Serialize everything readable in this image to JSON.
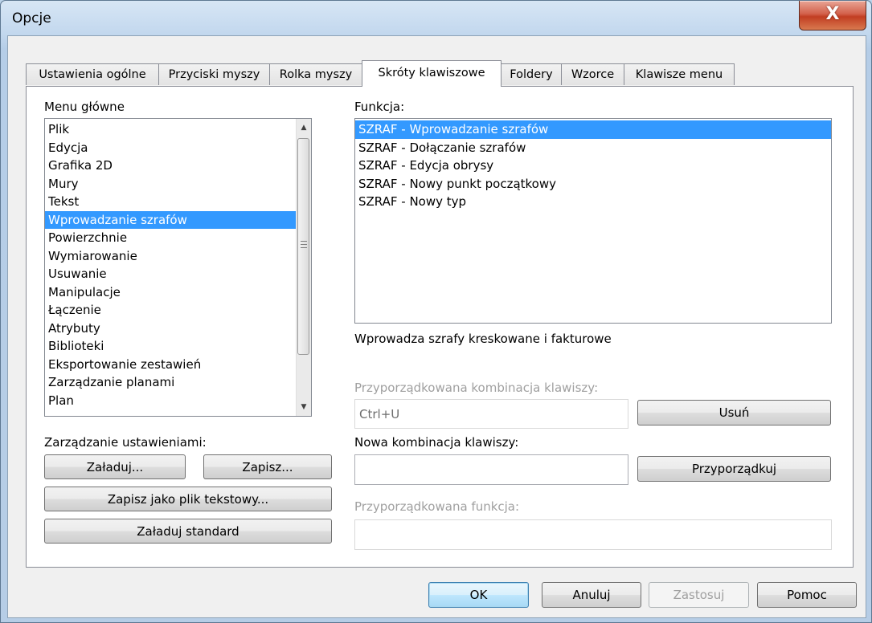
{
  "window": {
    "title": "Opcje",
    "close_glyph": "X"
  },
  "tabs": [
    {
      "label": "Ustawienia ogólne",
      "active": false
    },
    {
      "label": "Przyciski myszy",
      "active": false
    },
    {
      "label": "Rolka myszy",
      "active": false
    },
    {
      "label": "Skróty klawiszowe",
      "active": true
    },
    {
      "label": "Foldery",
      "active": false
    },
    {
      "label": "Wzorce",
      "active": false
    },
    {
      "label": "Klawisze menu",
      "active": false
    }
  ],
  "menu": {
    "label": "Menu główne",
    "items": [
      "Plik",
      "Edycja",
      "Grafika 2D",
      "Mury",
      "Tekst",
      "Wprowadzanie szrafów",
      "Powierzchnie",
      "Wymiarowanie",
      "Usuwanie",
      "Manipulacje",
      "Łączenie",
      "Atrybuty",
      "Biblioteki",
      "Eksportowanie zestawień",
      "Zarządzanie planami",
      "Plan"
    ],
    "selected_index": 5,
    "scroll_up_icon": "scroll-up-arrow",
    "scroll_down_icon": "scroll-down-arrow"
  },
  "settings": {
    "label": "Zarządzanie ustawieniami:",
    "load": "Załaduj...",
    "save": "Zapisz...",
    "save_text": "Zapisz jako plik tekstowy...",
    "load_standard": "Załaduj standard"
  },
  "function": {
    "label": "Funkcja:",
    "items": [
      "SZRAF - Wprowadzanie szrafów",
      "SZRAF - Dołączanie szrafów",
      "SZRAF - Edycja obrysy",
      "SZRAF - Nowy punkt początkowy",
      "SZRAF - Nowy typ"
    ],
    "selected_index": 0,
    "description": "Wprowadza szrafy kreskowane i fakturowe"
  },
  "assigned_combo": {
    "label": "Przyporządkowana kombinacja klawiszy:",
    "value": "Ctrl+U",
    "remove_button": "Usuń"
  },
  "new_combo": {
    "label": "Nowa kombinacja klawiszy:",
    "value": "",
    "assign_button": "Przyporządkuj"
  },
  "assigned_function": {
    "label": "Przyporządkowana funkcja:",
    "value": ""
  },
  "footer": {
    "ok": "OK",
    "cancel": "Anuluj",
    "apply": "Zastosuj",
    "help": "Pomoc"
  }
}
